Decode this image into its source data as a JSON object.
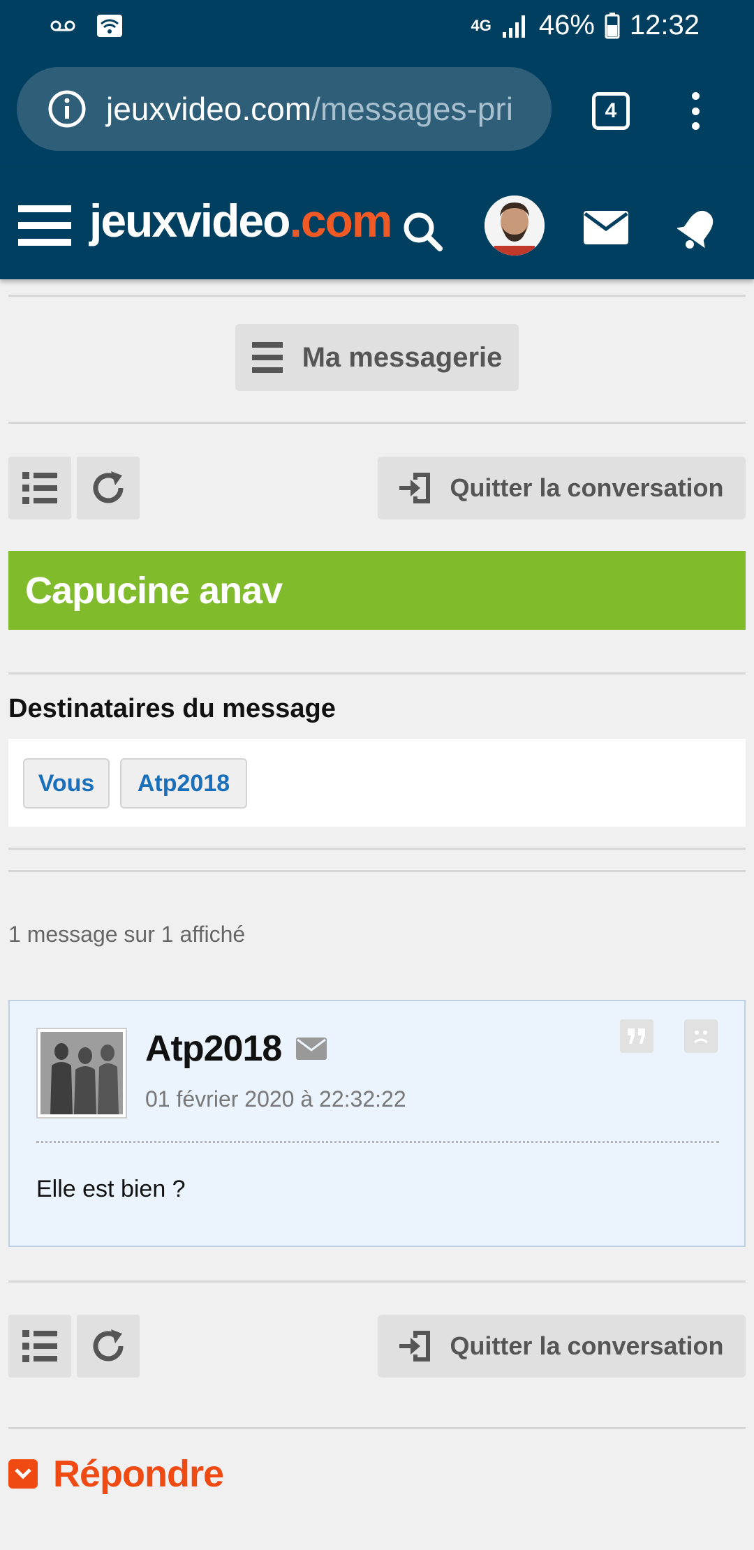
{
  "status_bar": {
    "network": "4G",
    "battery": "46%",
    "time": "12:32"
  },
  "browser": {
    "url_domain": "jeuxvideo.com",
    "url_path": "/messages-pri",
    "tab_count": "4"
  },
  "header": {
    "logo_main": "jeuxvideo",
    "logo_tld": ".com"
  },
  "page": {
    "messagerie_label": "Ma messagerie",
    "quit_label": "Quitter la conversation",
    "conversation_title": "Capucine anav",
    "recipients_heading": "Destinataires du message",
    "recipients": [
      "Vous",
      "Atp2018"
    ],
    "message_count": "1 message sur 1 affiché",
    "reply_label": "Répondre"
  },
  "message": {
    "author": "Atp2018",
    "date": "01 février 2020 à 22:32:22",
    "body": "Elle est bien ?"
  },
  "colors": {
    "header_bg": "#003f5f",
    "title_green": "#7fbb2b",
    "accent_orange": "#f04a13",
    "link_blue": "#1a6fba"
  }
}
